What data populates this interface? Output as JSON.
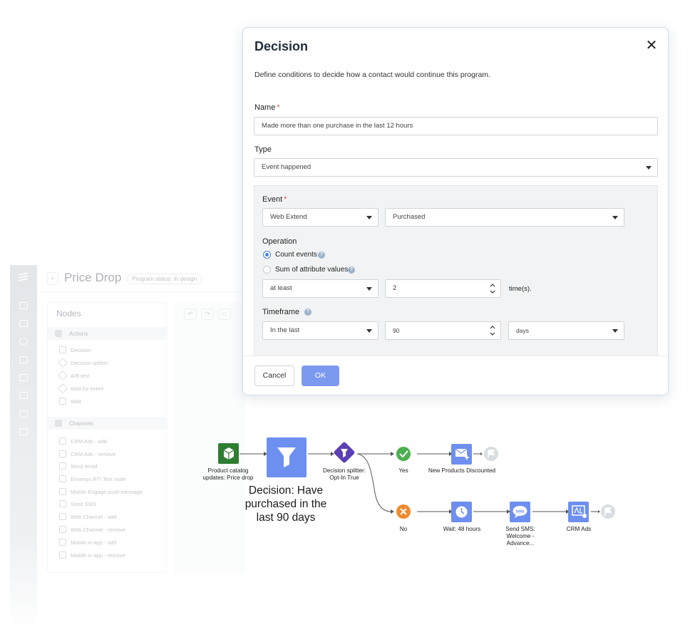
{
  "background_app": {
    "title": "Price Drop",
    "status_badge": "Program status: In design",
    "nodes_panel_title": "Nodes",
    "sections": [
      {
        "label": "Actions",
        "items": [
          "Decision",
          "Decision splitter",
          "A/B test",
          "Wait for event",
          "Wait"
        ]
      },
      {
        "label": "Channels",
        "items": [
          "CRM Ads - add",
          "CRM Ads - remove",
          "Send email",
          "Emarsys RTI Test node",
          "Mobile Engage push message",
          "Send SMS",
          "Web Channel - add",
          "Web Channel - remove",
          "Mobile in-app - add",
          "Mobile in-app - remove"
        ]
      }
    ]
  },
  "dialog": {
    "title": "Decision",
    "description": "Define conditions to decide how a contact would continue this program.",
    "name_label": "Name",
    "name_required": "*",
    "name_value": "Made more than one purchase in the last 12 hours",
    "type_label": "Type",
    "type_value": "Event happened",
    "event_label": "Event",
    "event_required": "*",
    "event_source": "Web Extend",
    "event_name": "Purchased",
    "operation_label": "Operation",
    "operation_options": [
      "Count events",
      "Sum of attribute values"
    ],
    "operation_selected": "Count events",
    "comparator": "at least",
    "count_value": "2",
    "count_unit": "time(s).",
    "timeframe_label": "Timeframe",
    "timeframe_mode": "In the last",
    "timeframe_value": "90",
    "timeframe_unit": "days",
    "cancel_label": "Cancel",
    "ok_label": "OK",
    "help_glyph": "?"
  },
  "flow": {
    "nodes": {
      "product_catalog": "Product catalog updates: Price drop",
      "decision_caption": "Decision: Have purchased in the last 90 days",
      "decision_splitter": "Decision splitter: Opt-In True",
      "yes": "Yes",
      "no": "No",
      "new_products": "New Products Discounted",
      "wait": "Wait: 48 hours",
      "send_sms": "Send SMS: Welcome - Advance...",
      "crm_ads": "CRM Ads",
      "sms_icon_text": "SMS"
    },
    "colors": {
      "node_blue": "#6d8ff0",
      "catalog_green": "#2f7d32",
      "splitter_purple": "#5b3fb5",
      "yes_green": "#4caf50",
      "no_orange": "#f08a2c",
      "end_flag_grey": "#d9dde1"
    }
  }
}
